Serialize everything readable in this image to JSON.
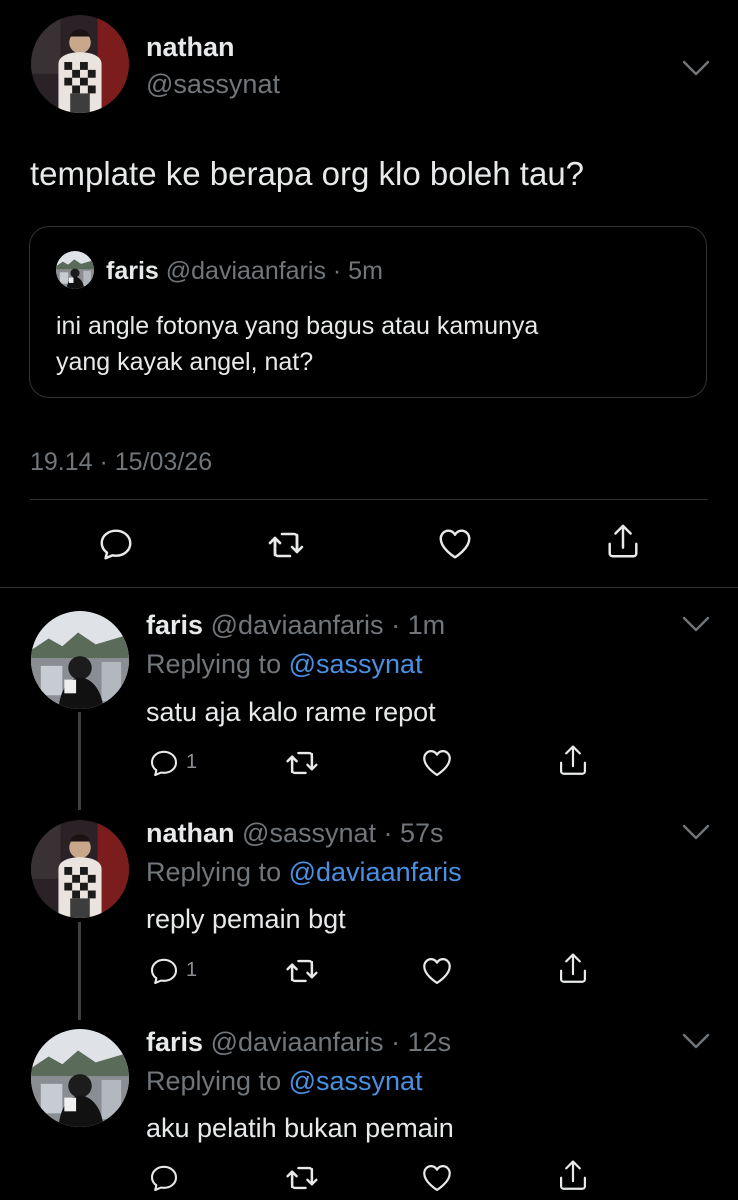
{
  "main_tweet": {
    "author_name": "nathan",
    "author_handle": "@sassynat",
    "text": "template ke berapa org klo boleh tau?",
    "timestamp": "19.14 · 15/03/26",
    "quoted": {
      "author_name": "faris",
      "author_handle": "@daviaanfaris",
      "age": "· 5m",
      "text_line1": "ini angle fotonya yang bagus atau kamunya",
      "text_line2": "yang kayak angel, nat?"
    }
  },
  "replies": [
    {
      "author_name": "faris",
      "author_handle": "@daviaanfaris",
      "age": "· 1m",
      "replying_label": "Replying to",
      "replying_to": "@sassynat",
      "text": "satu aja kalo rame repot",
      "reply_count": "1"
    },
    {
      "author_name": "nathan",
      "author_handle": "@sassynat",
      "age": "· 57s",
      "replying_label": "Replying to",
      "replying_to": "@daviaanfaris",
      "text": "reply pemain bgt",
      "reply_count": "1"
    },
    {
      "author_name": "faris",
      "author_handle": "@daviaanfaris",
      "age": "· 12s",
      "replying_label": "Replying to",
      "replying_to": "@sassynat",
      "text": "aku pelatih bukan pemain",
      "reply_count": ""
    }
  ],
  "colors": {
    "background": "#000000",
    "link": "#4a90e2",
    "muted": "#71767b",
    "divider": "#2f3336"
  },
  "icons": [
    "reply-icon",
    "retweet-icon",
    "like-icon",
    "share-icon",
    "chevron-down-icon"
  ]
}
